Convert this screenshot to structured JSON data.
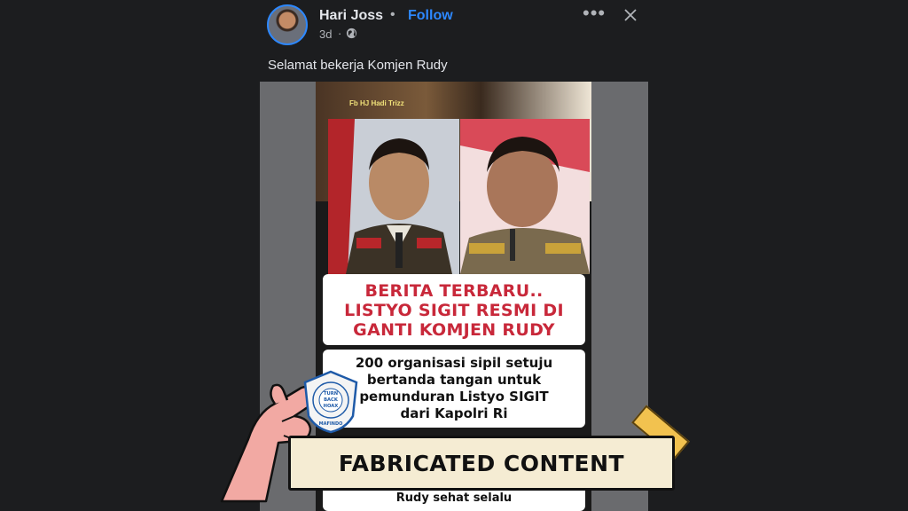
{
  "post": {
    "author": "Hari Joss",
    "separator": "•",
    "follow_label": "Follow",
    "time": "3d",
    "time_separator": "·",
    "caption": "Selamat bekerja Komjen Rudy"
  },
  "image": {
    "watermark": "Fb HJ Hadi Trizz",
    "headline_lines": [
      "BERITA TERBARU..",
      "LISTYO SIGIT RESMI DI",
      "GANTI KOMJEN RUDY"
    ],
    "sub_lines": [
      "200 organisasi sipil setuju",
      "bertanda tangan untuk",
      "pemunduran Listyo SIGIT",
      "dari Kapolri Ri"
    ],
    "bottom_text": "Rudy sehat selalu"
  },
  "overlay": {
    "label": "FABRICATED CONTENT",
    "seal_center_lines": [
      "TURN",
      "BACK",
      "HOAX"
    ],
    "seal_ring_text": "MASYARAKAT ANTI FITNAH INDONESIA",
    "seal_bottom": "MAFINDO"
  },
  "colors": {
    "background": "#1c1d1f",
    "accent": "#2d88ff",
    "headline_red": "#c8283a",
    "label_bg": "#f5ecd3",
    "tape": "#f2c24f"
  }
}
